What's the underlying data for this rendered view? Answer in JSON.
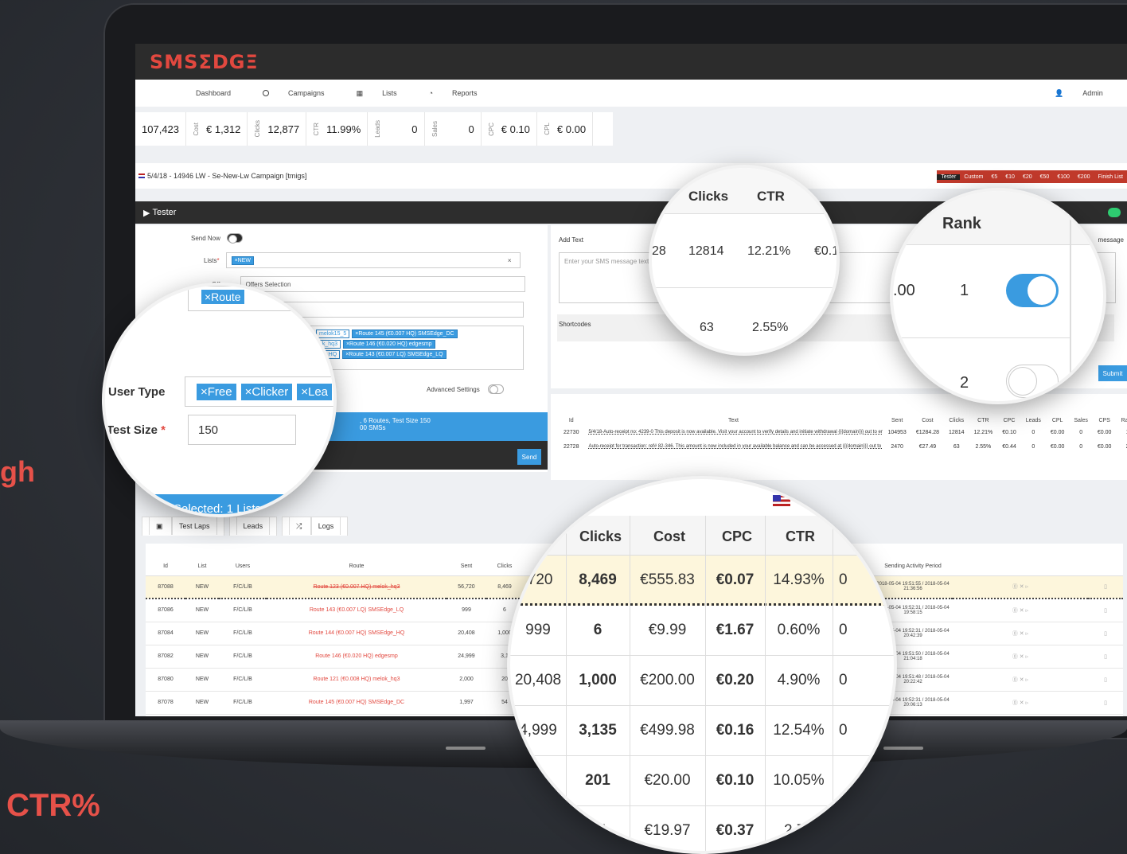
{
  "side": {
    "line1": "gh",
    "line2": "CTR%"
  },
  "app": {
    "logo": "SMSΣDGΞ"
  },
  "nav": {
    "items": [
      "Dashboard",
      "Campaigns",
      "Lists",
      "Reports"
    ],
    "admin": "Admin"
  },
  "stats": [
    {
      "label": "",
      "value": "107,423"
    },
    {
      "label": "Cost",
      "value": "€ 1,312"
    },
    {
      "label": "Clicks",
      "value": "12,877"
    },
    {
      "label": "CTR",
      "value": "11.99%"
    },
    {
      "label": "Leads",
      "value": "0"
    },
    {
      "label": "Sales",
      "value": "0"
    },
    {
      "label": "CPC",
      "value": "€ 0.10"
    },
    {
      "label": "CPL",
      "value": "€ 0.00"
    }
  ],
  "campaign": {
    "title": "5/4/18 - 14946 LW - Se-New-Lw Campaign [tmigs]",
    "quick_buttons": [
      "Tester",
      "Custom",
      "€5",
      "€10",
      "€20",
      "€50",
      "€100",
      "€200",
      "Finish List"
    ]
  },
  "tester": {
    "panel_title": "Tester",
    "send_now_label": "Send Now",
    "lists_label": "Lists",
    "lists_tag": "×NEW",
    "offers_label": "Offers",
    "offers_value": "Offers Selection",
    "route_tags": [
      "×Route 145 (€0.007 HQ) SMSEdge_DC",
      "×Route 146 (€0.020 HQ) edgesmp",
      "×Route 143 (€0.007 LQ) SMSEdge_LQ"
    ],
    "route_partial": [
      "melok15_5",
      "ok_hq3",
      "ge_HQ"
    ],
    "advanced_label": "Advanced Settings",
    "summary_line1": ", 6 Routes, Test Size 150",
    "summary_line2": "00 SMSs",
    "send_button": "Send"
  },
  "message": {
    "add_text_label": "Add Text",
    "placeholder": "Enter your SMS message text with",
    "shortcodes_label": "Shortcodes",
    "message_label": "message",
    "submit_label": "Submit"
  },
  "activity": {
    "headers": [
      "Id",
      "Text",
      "Sent",
      "Cost",
      "Clicks",
      "CTR",
      "CPC",
      "Leads",
      "CPL",
      "Sales",
      "CPS",
      "Rank"
    ],
    "rows": [
      {
        "id": "22730",
        "text": "5/4/18-Auto-receipt no: 4239-0 This deposit is now available. Visit your account to verify details and initiate withdrawal {{{domain}}} out to end",
        "sent": "104953",
        "cost": "€1284.28",
        "clicks": "12814",
        "ctr": "12.21%",
        "cpc": "€0.10",
        "leads": "0",
        "cpl": "€0.00",
        "sales": "0",
        "cps": "€0.00",
        "rank": "1"
      },
      {
        "id": "22728",
        "text": "Auto-receipt for transaction: ref# 82-346. This amount is now included in your available balance and can be accessed at {{{domain}}} out to end",
        "sent": "2470",
        "cost": "€27.49",
        "clicks": "63",
        "ctr": "2.55%",
        "cpc": "€0.44",
        "leads": "0",
        "cpl": "€0.00",
        "sales": "0",
        "cps": "€0.00",
        "rank": "2"
      }
    ]
  },
  "laps": {
    "tabs": [
      "Test Laps",
      "Leads",
      "Logs"
    ],
    "selected_banner": "Selected: 1 Lists",
    "headers": [
      "Id",
      "List",
      "Users",
      "Route",
      "Sent",
      "Clicks",
      "Sending Activity Period"
    ],
    "rows": [
      {
        "id": "87088",
        "list": "NEW",
        "users": "F/C/L/B",
        "route": "Route 123 (€0.007 HQ) melok_hq3",
        "sent": "56,720",
        "clicks": "8,469",
        "period": "2018-05-04 19:51:55 / 2018-05-04 21:36:56",
        "strike": true
      },
      {
        "id": "87086",
        "list": "NEW",
        "users": "F/C/L/B",
        "route": "Route 143 (€0.007 LQ) SMSEdge_LQ",
        "sent": "999",
        "clicks": "6",
        "period": "2018-05-04 19:52:31 / 2018-05-04 19:58:15",
        "strike": false
      },
      {
        "id": "87084",
        "list": "NEW",
        "users": "F/C/L/B",
        "route": "Route 144 (€0.007 HQ) SMSEdge_HQ",
        "sent": "20,408",
        "clicks": "1,000",
        "period": "2018-05-04 19:52:31 / 2018-05-04 20:42:39",
        "strike": false
      },
      {
        "id": "87082",
        "list": "NEW",
        "users": "F/C/L/B",
        "route": "Route 146 (€0.020 HQ) edgesmp",
        "sent": "24,999",
        "clicks": "3,1",
        "period": "2018-05-04 19:51:50 / 2018-05-04 21:04:18",
        "strike": false
      },
      {
        "id": "87080",
        "list": "NEW",
        "users": "F/C/L/B",
        "route": "Route 121 (€0.008 HQ) melok_hq3",
        "sent": "2,000",
        "clicks": "20",
        "period": "2018-05-04 19:51:48 / 2018-05-04 20:22:42",
        "strike": false
      },
      {
        "id": "87078",
        "list": "NEW",
        "users": "F/C/L/B",
        "route": "Route 145 (€0.007 HQ) SMSEdge_DC",
        "sent": "1,997",
        "clicks": "54",
        "period": "2018-05-04 19:52:31 / 2018-05-04 20:06:13",
        "strike": false
      }
    ]
  },
  "zoom_top": {
    "headers": [
      "Clicks",
      "CTR"
    ],
    "rows": [
      [
        "28",
        "12814",
        "12.21%",
        "€0.1"
      ],
      [
        "",
        "63",
        "2.55%",
        ""
      ]
    ]
  },
  "zoom_rank": {
    "header": "Rank",
    "prefix": ".00",
    "ranks": [
      "1",
      "2"
    ]
  },
  "zoom_user": {
    "user_type_label": "User Type",
    "user_tags": [
      "×Free",
      "×Clicker",
      "×Lea"
    ],
    "test_size_label": "Test Size",
    "test_size_value": "150",
    "route_tag": "×Route",
    "selected_banner": "Selected: 1 Lists"
  },
  "zoom_big": {
    "headers": [
      "Clicks",
      "Cost",
      "CPC",
      "CTR"
    ],
    "rows": [
      {
        "sent": ",720",
        "clicks": "8,469",
        "cost": "€555.83",
        "cpc": "€0.07",
        "ctr": "14.93%",
        "leads": "0"
      },
      {
        "sent": "999",
        "clicks": "6",
        "cost": "€9.99",
        "cpc": "€1.67",
        "ctr": "0.60%",
        "leads": "0"
      },
      {
        "sent": "20,408",
        "clicks": "1,000",
        "cost": "€200.00",
        "cpc": "€0.20",
        "ctr": "4.90%",
        "leads": "0"
      },
      {
        "sent": "4,999",
        "clicks": "3,135",
        "cost": "€499.98",
        "cpc": "€0.16",
        "ctr": "12.54%",
        "leads": "0"
      },
      {
        "sent": "0",
        "clicks": "201",
        "cost": "€20.00",
        "cpc": "€0.10",
        "ctr": "10.05%",
        "leads": ""
      },
      {
        "sent": "",
        "clicks": "54",
        "cost": "€19.97",
        "cpc": "€0.37",
        "ctr": "2.70",
        "leads": ""
      }
    ]
  },
  "colors": {
    "brand": "#e2483f",
    "accent": "#3a9be0",
    "dark": "#2c2c2c"
  }
}
